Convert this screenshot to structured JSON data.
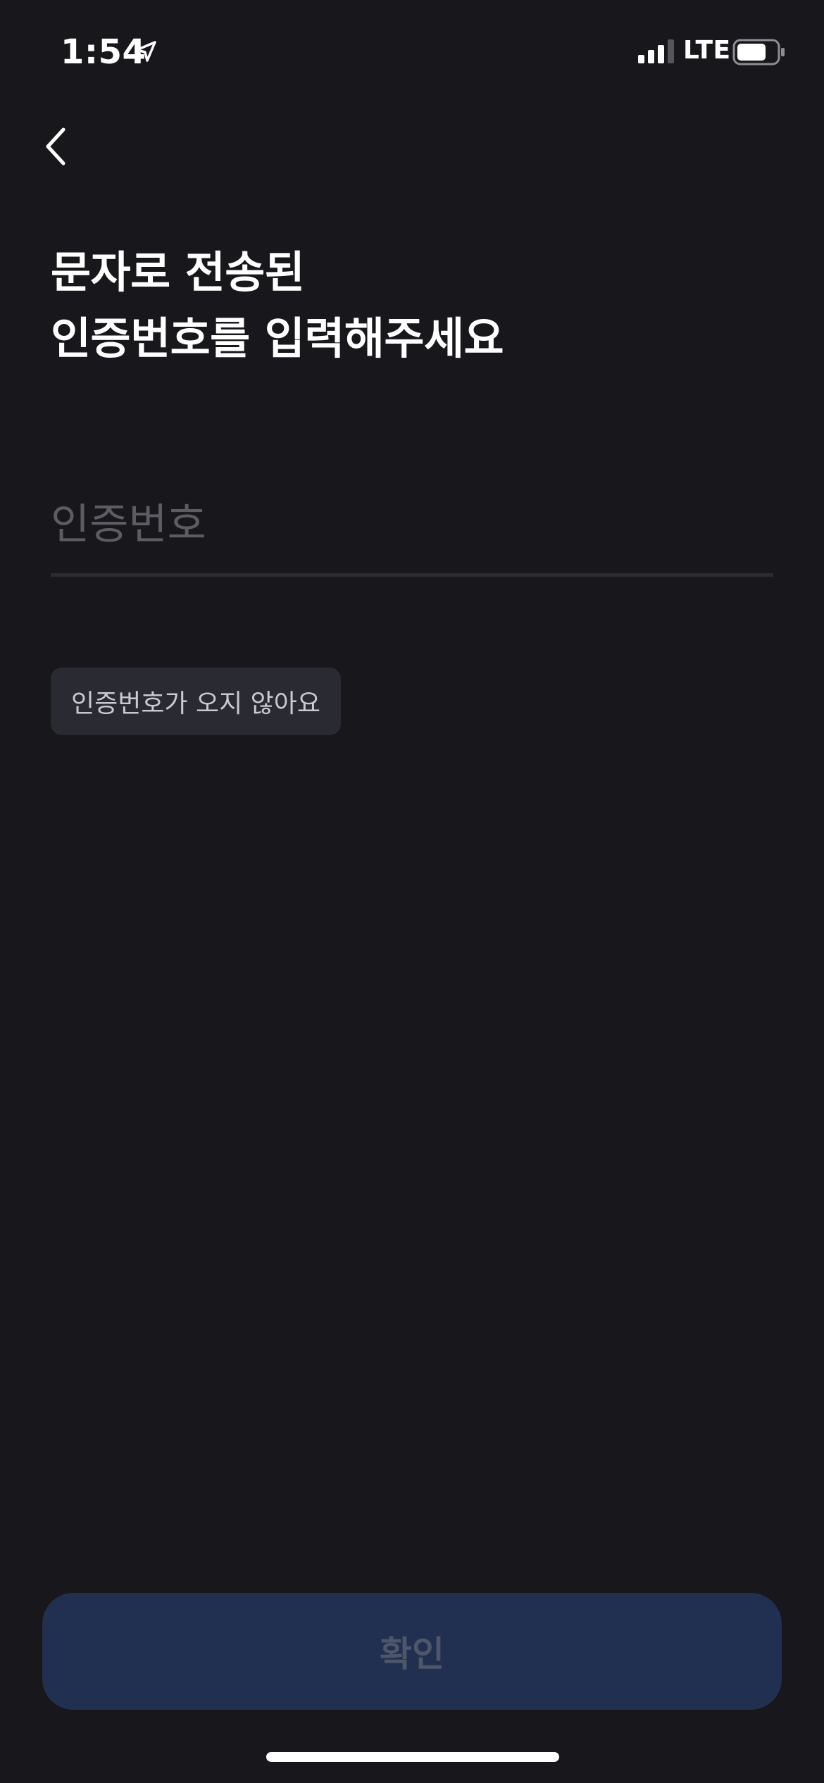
{
  "status_bar": {
    "time": "1:54",
    "network": "LTE",
    "icons": [
      "location-arrow-icon",
      "signal-bars-icon",
      "battery-icon"
    ]
  },
  "nav": {
    "back_icon": "chevron-left-icon"
  },
  "title": {
    "line1": "문자로 전송된",
    "line2": "인증번호를 입력해주세요"
  },
  "code_input": {
    "value": "",
    "placeholder": "인증번호"
  },
  "no_code_label": "인증번호가 오지 않아요",
  "confirm_label": "확인",
  "colors": {
    "background": "#18171c",
    "chip_background": "#2a2a33",
    "confirm_background": "#213050",
    "confirm_text_disabled": "#4e5669",
    "placeholder": "#5c5c63",
    "underline": "#2c2c33"
  }
}
